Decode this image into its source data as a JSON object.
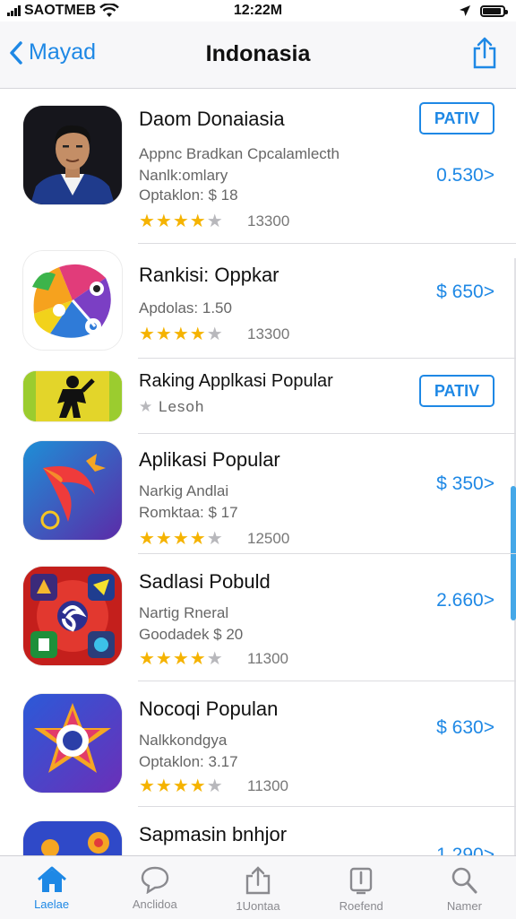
{
  "status_bar": {
    "carrier": "SAOTMEB",
    "time": "12:22M"
  },
  "nav": {
    "back_label": "Mayad",
    "title": "Indonasia"
  },
  "apps": [
    {
      "title": "Daom Donaiasia",
      "lines": [
        "Appnc Bradkan Cpcalamlecth",
        "Nanlk:omlary",
        "Optaklon: $ 18"
      ],
      "rating": 4,
      "count": "13300",
      "action_type": "price",
      "action": "0.530>",
      "get_label": "PATIV"
    },
    {
      "title": "Rankisi: Oppkar",
      "lines": [
        "Apdolas: 1.50"
      ],
      "rating": 4,
      "count": "13300",
      "action_type": "price",
      "action": "$ 650>"
    },
    {
      "title": "Raking Applkasi Popular",
      "lines": [
        "Lesoh"
      ],
      "rating": 1,
      "count": "",
      "action_type": "button",
      "action": "PATIV"
    },
    {
      "title": "Aplikasi Popular",
      "lines": [
        "Narkig Andlai",
        "Romktaa: $ 17"
      ],
      "rating": 4,
      "count": "12500",
      "action_type": "price",
      "action": "$ 350>"
    },
    {
      "title": "Sadlasi Pobuld",
      "lines": [
        "Nartig Rneral",
        "Goodadek $ 20"
      ],
      "rating": 4,
      "count": "11300",
      "action_type": "price",
      "action": "2.660>"
    },
    {
      "title": "Nocoqi Populan",
      "lines": [
        "Nalkkondgya",
        "Optaklon: 3.17"
      ],
      "rating": 4,
      "count": "11300",
      "action_type": "price",
      "action": "$ 630>"
    },
    {
      "title": "Sapmasin bnhjor",
      "lines": [],
      "rating": 0,
      "count": "",
      "action_type": "price",
      "action": "1.290>"
    }
  ],
  "tabs": [
    {
      "label": "Laelae",
      "icon": "home-icon",
      "active": true
    },
    {
      "label": "Anclidoa",
      "icon": "chat-bubble-icon",
      "active": false
    },
    {
      "label": "1Uontaa",
      "icon": "upload-icon",
      "active": false
    },
    {
      "label": "Roefend",
      "icon": "download-icon",
      "active": false
    },
    {
      "label": "Namer",
      "icon": "search-icon",
      "active": false
    }
  ],
  "colors": {
    "accent": "#1e88e5",
    "star": "#f5b301",
    "background": "#ffffff",
    "bar": "#f7f7f9"
  }
}
